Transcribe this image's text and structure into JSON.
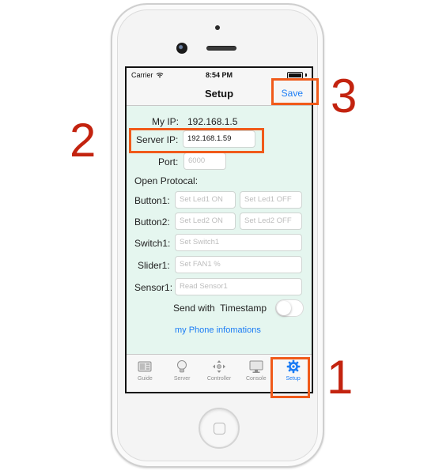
{
  "status_bar": {
    "carrier": "Carrier",
    "time": "8:54 PM",
    "wifi_icon": "wifi-icon",
    "battery_icon": "battery-icon"
  },
  "nav": {
    "title": "Setup",
    "save_label": "Save"
  },
  "form": {
    "my_ip_label": "My IP:",
    "my_ip_value": "192.168.1.5",
    "server_ip_label": "Server IP:",
    "server_ip_value": "192.168.1.59",
    "port_label": "Port:",
    "port_placeholder": "6000",
    "open_protocol_label": "Open Protocal:",
    "button1_label": "Button1:",
    "button1_on_placeholder": "Set Led1 ON",
    "button1_off_placeholder": "Set Led1 OFF",
    "button2_label": "Button2:",
    "button2_on_placeholder": "Set Led2 ON",
    "button2_off_placeholder": "Set Led2 OFF",
    "switch1_label": "Switch1:",
    "switch1_placeholder": "Set Switch1",
    "slider1_label": "Slider1:",
    "slider1_placeholder": "Set FAN1 %",
    "sensor1_label": "Sensor1:",
    "sensor1_placeholder": "Read Sensor1",
    "timestamp_label": "Send with  Timestamp",
    "timestamp_on": false,
    "phone_info_link": "my Phone infomations"
  },
  "tabs": [
    {
      "label": "Guide",
      "icon": "guide-icon",
      "active": false
    },
    {
      "label": "Server",
      "icon": "lightbulb-icon",
      "active": false
    },
    {
      "label": "Controller",
      "icon": "dpad-icon",
      "active": false
    },
    {
      "label": "Console",
      "icon": "monitor-icon",
      "active": false
    },
    {
      "label": "Setup",
      "icon": "gear-icon",
      "active": true
    }
  ],
  "annotations": {
    "marker_1": "1",
    "marker_2": "2",
    "marker_3": "3",
    "highlight_color": "#f05a1a",
    "number_color": "#c3230f"
  },
  "colors": {
    "accent": "#1a7cf5",
    "screen_background": "#e5f6ef"
  }
}
